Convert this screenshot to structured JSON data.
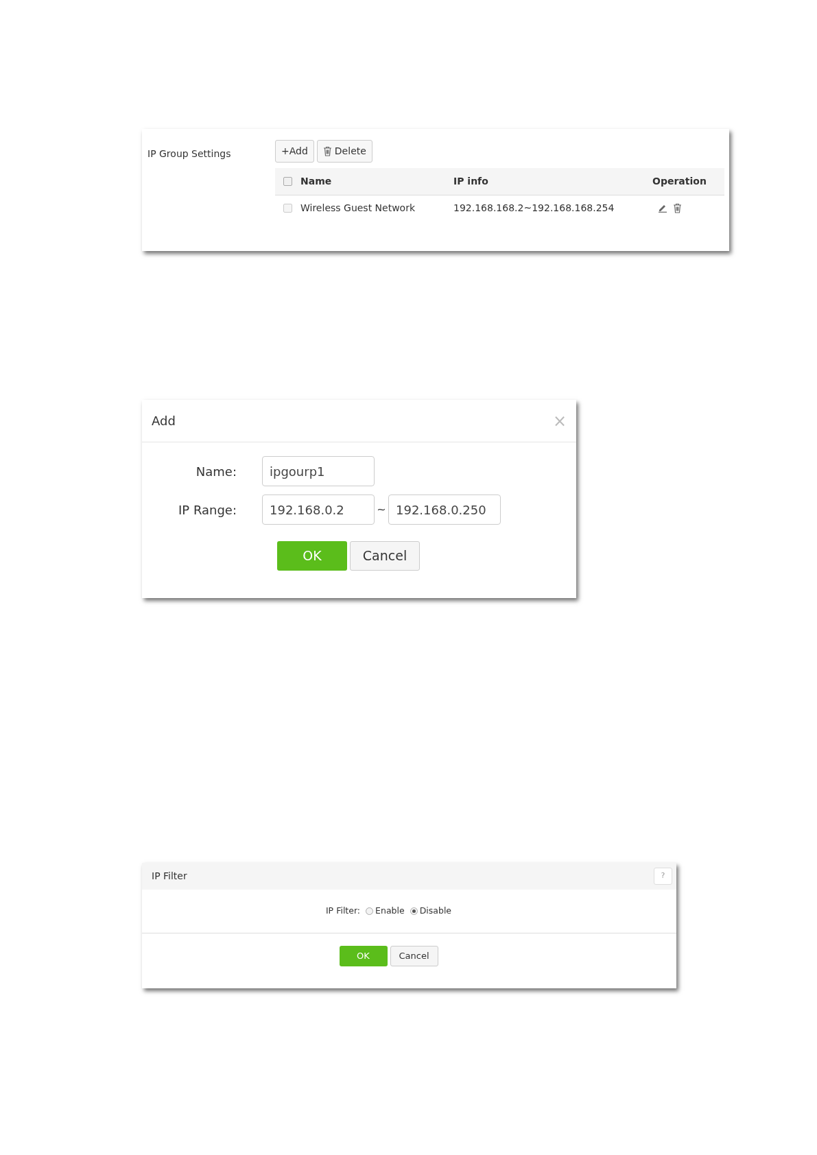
{
  "ip_group_settings": {
    "title": "IP Group Settings",
    "buttons": [
      {
        "kind": "add",
        "label": "+Add"
      },
      {
        "kind": "delete",
        "label": "Delete"
      }
    ],
    "table": {
      "header_checked": false,
      "columns": [
        "Name",
        "IP info",
        "Operation"
      ],
      "rows": [
        {
          "checked": false,
          "name": "Wireless Guest Network",
          "ip_info": "192.168.168.2~192.168.168.254"
        }
      ]
    }
  },
  "add_dialog": {
    "title": "Add",
    "close": "×",
    "fields": [
      {
        "label": "Name:",
        "values": [
          "ipgourp1"
        ]
      },
      {
        "label": "IP Range:",
        "values": [
          "192.168.0.2",
          "192.168.0.250"
        ],
        "separator": "~"
      }
    ],
    "buttons": [
      {
        "kind": "primary",
        "label": "OK"
      },
      {
        "kind": "secondary",
        "label": "Cancel"
      }
    ]
  },
  "ip_filter": {
    "title": "IP Filter",
    "help": "?",
    "label": "IP Filter:",
    "options": [
      {
        "label": "Enable",
        "selected": false
      },
      {
        "label": "Disable",
        "selected": true
      }
    ],
    "buttons": [
      {
        "kind": "primary",
        "label": "OK"
      },
      {
        "kind": "secondary",
        "label": "Cancel"
      }
    ]
  }
}
